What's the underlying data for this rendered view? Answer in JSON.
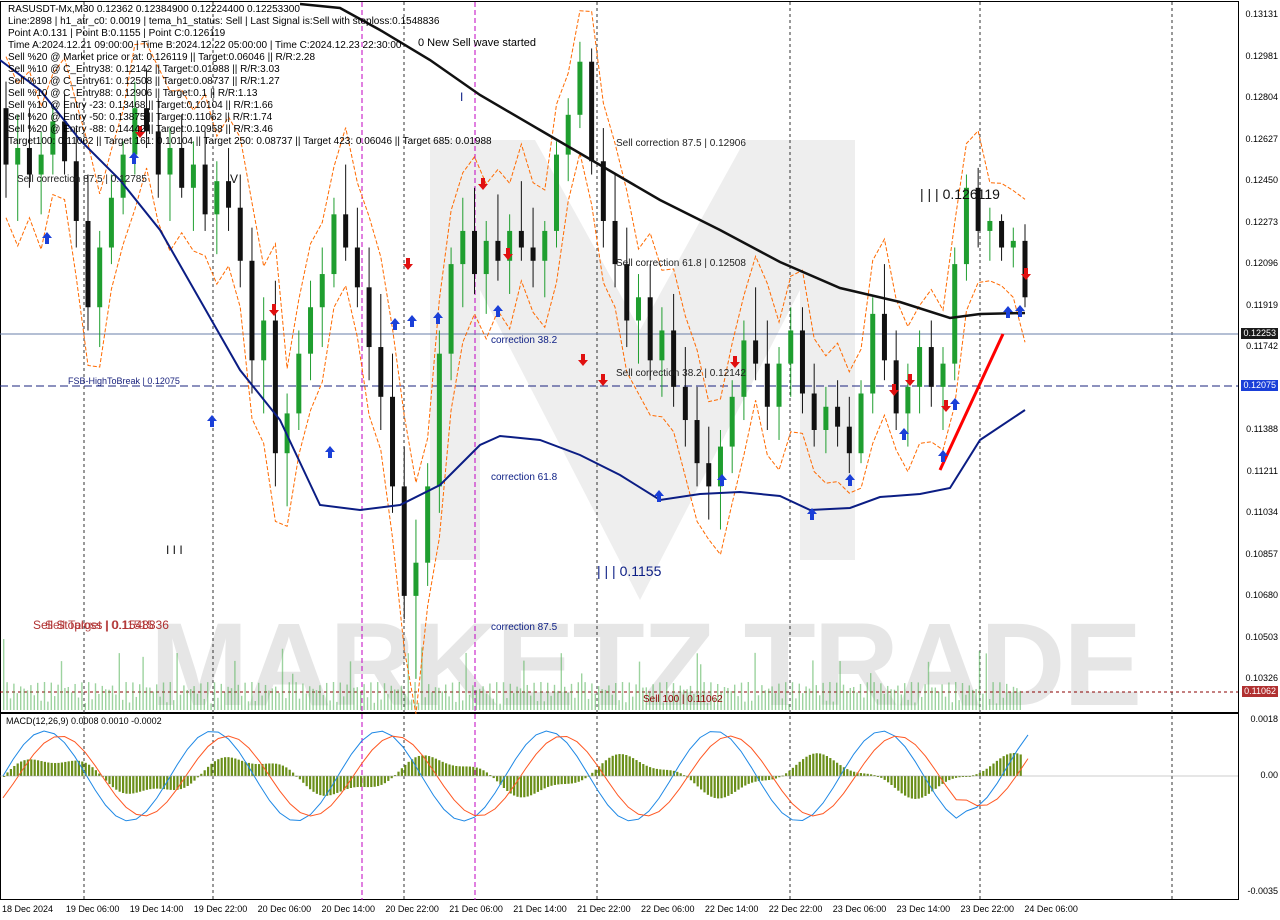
{
  "header": {
    "lines": [
      "RASUSDT-Mx,M30  0.12362  0.12384900  0.12224400  0.12253300",
      "Line:2898 | h1_atr_c0: 0.0019 | tema_h1_status: Sell | Last Signal is:Sell with stoploss:0.1548836",
      "Point A:0.131 | Point B:0.1155 | Point C:0.126119",
      "Time A:2024.12.21 09:00:00 | Time B:2024.12.22 05:00:00 | Time C:2024.12.23 22:30:00",
      "Sell %20 @ Market price or at: 0.126119 || Target:0.06046 || R/R:2.28",
      "Sell %10 @ C_Entry38: 0.12142 || Target:0.01988 || R/R:3.03",
      "Sell %10 @ C_Entry61: 0.12508 || Target:0.08737 || R/R:1.27",
      "Sell %10 @ C_Entry88: 0.12906 || Target:0.1 || R/R:1.13",
      "Sell %10 @ Entry -23: 0.13468 || Target:0.10104 || R/R:1.66",
      "Sell %20 @ Entry -50: 0.13875 || Target:0.11062 || R/R:1.74",
      "Sell %20 @ Entry -88: 0.14442 || Target:0.10958 || R/R:3.46",
      "Target100: 0.11062 || Target 161: 0.10104 || Target 250: 0.08737 || Target 423: 0.06046 || Target 685: 0.01988"
    ]
  },
  "annotations": {
    "new_wave": "0 New Sell wave started",
    "corr875_top": "Sell correction 87.5 | 0.12906",
    "corr618_top": "Sell correction 61.8 | 0.12508",
    "corr382_top": "Sell correction 38.2 | 0.12142",
    "point_c": "| | | 0.126119",
    "point_b": "| | | 0.1155",
    "corr382": "correction 38.2",
    "corr618": "correction 61.8",
    "corr875": "correction 87.5",
    "fsb": "FSB-HighToBreak | 0.12075",
    "sell_stoploss": "Sell Stoploss | 0.1548836",
    "sell_target": "Sell Target | 0.11515",
    "sell100": "Sell 100 | 0.11062",
    "left_corr": "Sell correction 87.5 | 0.12785",
    "wave_v": "V",
    "wave_i": "I",
    "wave_iii": "I I I",
    "watermark": "MARKETZ TRADE"
  },
  "macd": {
    "label": "MACD(12,26,9) 0.0008 0.0010 -0.0002",
    "axis_labels": [
      "0.0018",
      "0.00",
      "-0.0035"
    ]
  },
  "price_axis": {
    "labels": [
      "0.13131",
      "0.12981",
      "0.12804",
      "0.12627",
      "0.12450",
      "0.12273",
      "0.12096",
      "0.11919",
      "0.11742",
      "0.11565",
      "0.11388",
      "0.11211",
      "0.11034",
      "0.10857",
      "0.10680",
      "0.10503",
      "0.10326"
    ],
    "current_price_tag": "0.12253",
    "fsb_price_tag": "0.12075",
    "sell100_price_tag": "0.11062"
  },
  "time_axis": {
    "labels": [
      "18 Dec 2024",
      "19 Dec 06:00",
      "19 Dec 14:00",
      "19 Dec 22:00",
      "20 Dec 06:00",
      "20 Dec 14:00",
      "20 Dec 22:00",
      "21 Dec 06:00",
      "21 Dec 14:00",
      "21 Dec 22:00",
      "22 Dec 06:00",
      "22 Dec 14:00",
      "22 Dec 22:00",
      "23 Dec 06:00",
      "23 Dec 14:00",
      "23 Dec 22:00",
      "24 Dec 06:00"
    ]
  },
  "colors": {
    "bull_candle": "#1f9e2f",
    "bear_candle": "#111111",
    "ma_black": "#111111",
    "ma_blue": "#0b1d84",
    "envelope": "#ff6a00",
    "macd_hist": "#6a8f1a",
    "macd_line": "#1e88e5",
    "signal_line": "#ff5722",
    "fsb_line": "#1a237e",
    "sell100_line": "#8b0000",
    "buy_arrow": "#1a3fd8",
    "sell_arrow": "#e01010",
    "trend_line": "#ff0000"
  },
  "chart_data": {
    "type": "candlestick",
    "symbol": "RASUSDT-Mx",
    "timeframe": "M30",
    "ylim": [
      0.11,
      0.1314
    ],
    "last": {
      "open": 0.12362,
      "high": 0.12385,
      "low": 0.12224,
      "close": 0.12253
    },
    "levels": {
      "fsb_high_to_break": 0.12075,
      "sell_100": 0.11062,
      "point_c": 0.126119,
      "point_b": 0.1155
    },
    "ohlc_approx": [
      [
        0.1282,
        0.129,
        0.1255,
        0.1265
      ],
      [
        0.1265,
        0.128,
        0.1248,
        0.127
      ],
      [
        0.127,
        0.1282,
        0.1258,
        0.1262
      ],
      [
        0.1262,
        0.1275,
        0.125,
        0.1268
      ],
      [
        0.1268,
        0.1283,
        0.1262,
        0.1278
      ],
      [
        0.1278,
        0.1286,
        0.1262,
        0.1266
      ],
      [
        0.1266,
        0.1276,
        0.124,
        0.1248
      ],
      [
        0.1248,
        0.1262,
        0.1215,
        0.1222
      ],
      [
        0.1222,
        0.1245,
        0.121,
        0.124
      ],
      [
        0.124,
        0.1262,
        0.1235,
        0.1255
      ],
      [
        0.1255,
        0.1272,
        0.125,
        0.1268
      ],
      [
        0.1268,
        0.129,
        0.1262,
        0.1282
      ],
      [
        0.1282,
        0.1294,
        0.127,
        0.1275
      ],
      [
        0.1275,
        0.1285,
        0.1255,
        0.1262
      ],
      [
        0.1262,
        0.1276,
        0.1248,
        0.127
      ],
      [
        0.127,
        0.128,
        0.1255,
        0.1258
      ],
      [
        0.1258,
        0.1272,
        0.1245,
        0.1265
      ],
      [
        0.1265,
        0.1275,
        0.1245,
        0.125
      ],
      [
        0.125,
        0.1266,
        0.1238,
        0.126
      ],
      [
        0.126,
        0.127,
        0.1245,
        0.1252
      ],
      [
        0.1252,
        0.1262,
        0.1228,
        0.1236
      ],
      [
        0.1236,
        0.1246,
        0.1196,
        0.1206
      ],
      [
        0.1206,
        0.1225,
        0.119,
        0.1218
      ],
      [
        0.1218,
        0.123,
        0.1168,
        0.1178
      ],
      [
        0.1178,
        0.1196,
        0.1162,
        0.119
      ],
      [
        0.119,
        0.1215,
        0.1185,
        0.1208
      ],
      [
        0.1208,
        0.123,
        0.12,
        0.1222
      ],
      [
        0.1222,
        0.124,
        0.121,
        0.1232
      ],
      [
        0.1232,
        0.1255,
        0.1228,
        0.125
      ],
      [
        0.125,
        0.1265,
        0.1236,
        0.124
      ],
      [
        0.124,
        0.1252,
        0.1222,
        0.1228
      ],
      [
        0.1228,
        0.124,
        0.12,
        0.121
      ],
      [
        0.121,
        0.1226,
        0.1185,
        0.1195
      ],
      [
        0.1195,
        0.1208,
        0.116,
        0.1168
      ],
      [
        0.1168,
        0.118,
        0.1128,
        0.1135
      ],
      [
        0.1135,
        0.1158,
        0.111,
        0.1145
      ],
      [
        0.1145,
        0.1175,
        0.1138,
        0.1168
      ],
      [
        0.1168,
        0.1215,
        0.116,
        0.1208
      ],
      [
        0.1208,
        0.124,
        0.12,
        0.1235
      ],
      [
        0.1235,
        0.1255,
        0.1222,
        0.1245
      ],
      [
        0.1245,
        0.1258,
        0.1226,
        0.1232
      ],
      [
        0.1232,
        0.1248,
        0.122,
        0.1242
      ],
      [
        0.1242,
        0.1256,
        0.123,
        0.1236
      ],
      [
        0.1236,
        0.125,
        0.1226,
        0.1245
      ],
      [
        0.1245,
        0.126,
        0.1236,
        0.124
      ],
      [
        0.124,
        0.1252,
        0.1228,
        0.1236
      ],
      [
        0.1236,
        0.1248,
        0.1225,
        0.1245
      ],
      [
        0.1245,
        0.1272,
        0.124,
        0.1268
      ],
      [
        0.1268,
        0.1285,
        0.126,
        0.128
      ],
      [
        0.128,
        0.1302,
        0.1276,
        0.1296
      ],
      [
        0.1296,
        0.13,
        0.1262,
        0.1266
      ],
      [
        0.1266,
        0.1276,
        0.124,
        0.1248
      ],
      [
        0.1248,
        0.1262,
        0.1228,
        0.1235
      ],
      [
        0.1235,
        0.1246,
        0.121,
        0.1218
      ],
      [
        0.1218,
        0.1232,
        0.1205,
        0.1225
      ],
      [
        0.1225,
        0.1235,
        0.12,
        0.1206
      ],
      [
        0.1206,
        0.1222,
        0.1195,
        0.1215
      ],
      [
        0.1215,
        0.1226,
        0.1192,
        0.1198
      ],
      [
        0.1198,
        0.121,
        0.118,
        0.1188
      ],
      [
        0.1188,
        0.1198,
        0.1168,
        0.1175
      ],
      [
        0.1175,
        0.1186,
        0.1158,
        0.1168
      ],
      [
        0.1168,
        0.1185,
        0.1155,
        0.118
      ],
      [
        0.118,
        0.12,
        0.1172,
        0.1195
      ],
      [
        0.1195,
        0.1218,
        0.1188,
        0.1212
      ],
      [
        0.1212,
        0.1228,
        0.12,
        0.1205
      ],
      [
        0.1205,
        0.1218,
        0.1185,
        0.1192
      ],
      [
        0.1192,
        0.121,
        0.1182,
        0.1205
      ],
      [
        0.1205,
        0.1222,
        0.1195,
        0.1215
      ],
      [
        0.1215,
        0.1222,
        0.119,
        0.1196
      ],
      [
        0.1196,
        0.1205,
        0.118,
        0.1185
      ],
      [
        0.1185,
        0.1198,
        0.1178,
        0.1192
      ],
      [
        0.1192,
        0.12,
        0.118,
        0.1186
      ],
      [
        0.1186,
        0.1195,
        0.1172,
        0.1178
      ],
      [
        0.1178,
        0.12,
        0.1175,
        0.1196
      ],
      [
        0.1196,
        0.1225,
        0.119,
        0.122
      ],
      [
        0.122,
        0.1235,
        0.12,
        0.1206
      ],
      [
        0.1206,
        0.1215,
        0.1185,
        0.119
      ],
      [
        0.119,
        0.1205,
        0.118,
        0.1198
      ],
      [
        0.1198,
        0.1215,
        0.119,
        0.121
      ],
      [
        0.121,
        0.1218,
        0.1192,
        0.1198
      ],
      [
        0.1198,
        0.121,
        0.1185,
        0.1205
      ],
      [
        0.1205,
        0.124,
        0.12,
        0.1235
      ],
      [
        0.1235,
        0.1262,
        0.123,
        0.1258
      ],
      [
        0.1258,
        0.1264,
        0.124,
        0.1245
      ],
      [
        0.1245,
        0.1252,
        0.1236,
        0.1248
      ],
      [
        0.1248,
        0.125,
        0.1236,
        0.124
      ],
      [
        0.124,
        0.1246,
        0.1234,
        0.1242
      ],
      [
        0.1242,
        0.1247,
        0.1222,
        0.1225
      ]
    ]
  }
}
